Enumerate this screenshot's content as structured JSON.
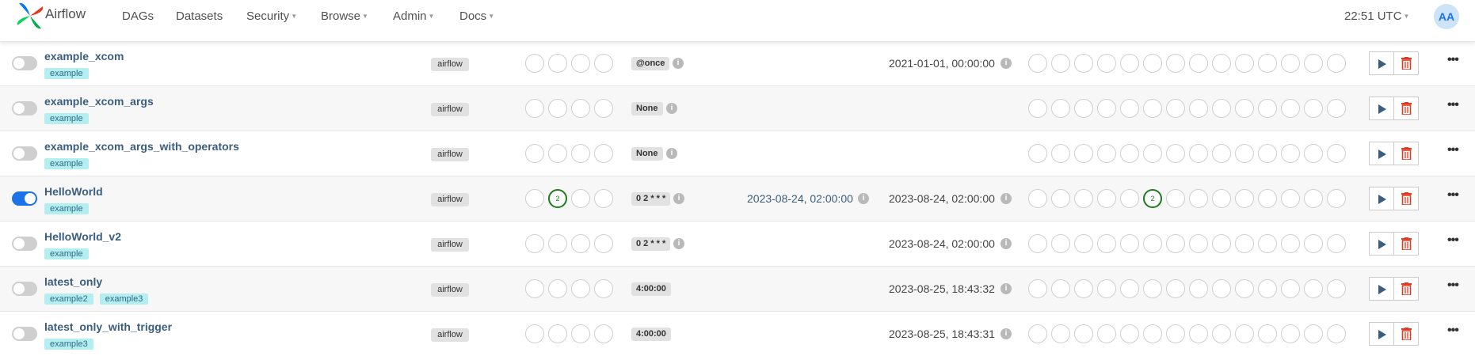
{
  "nav": {
    "brand": "Airflow",
    "items": [
      "DAGs",
      "Datasets",
      "Security",
      "Browse",
      "Admin",
      "Docs"
    ],
    "clock": "22:51 UTC",
    "avatar": "AA"
  },
  "rows": [
    {
      "name": "example_xcom",
      "tags": [
        "example"
      ],
      "owner": "airflow",
      "schedule": "@once",
      "next_run": "",
      "last_run": "2021-01-01, 00:00:00",
      "paused": true,
      "recent_success_slot": -1,
      "recent_success_count": "",
      "run_success_slot": -1,
      "run_success_count": ""
    },
    {
      "name": "example_xcom_args",
      "tags": [
        "example"
      ],
      "owner": "airflow",
      "schedule": "None",
      "next_run": "",
      "last_run": "",
      "paused": true,
      "recent_success_slot": -1,
      "recent_success_count": "",
      "run_success_slot": -1,
      "run_success_count": ""
    },
    {
      "name": "example_xcom_args_with_operators",
      "tags": [
        "example"
      ],
      "owner": "airflow",
      "schedule": "None",
      "next_run": "",
      "last_run": "",
      "paused": true,
      "recent_success_slot": -1,
      "recent_success_count": "",
      "run_success_slot": -1,
      "run_success_count": ""
    },
    {
      "name": "HelloWorld",
      "tags": [
        "example"
      ],
      "owner": "airflow",
      "schedule": "0 2 * * *",
      "next_run": "2023-08-24, 02:00:00",
      "last_run": "2023-08-24, 02:00:00",
      "paused": false,
      "recent_success_slot": 1,
      "recent_success_count": "2",
      "run_success_slot": 5,
      "run_success_count": "2"
    },
    {
      "name": "HelloWorld_v2",
      "tags": [
        "example"
      ],
      "owner": "airflow",
      "schedule": "0 2 * * *",
      "next_run": "",
      "last_run": "2023-08-24, 02:00:00",
      "paused": true,
      "recent_success_slot": -1,
      "recent_success_count": "",
      "run_success_slot": -1,
      "run_success_count": ""
    },
    {
      "name": "latest_only",
      "tags": [
        "example2",
        "example3"
      ],
      "owner": "airflow",
      "schedule": "4:00:00",
      "next_run": "",
      "last_run": "2023-08-25, 18:43:32",
      "paused": true,
      "recent_success_slot": -1,
      "recent_success_count": "",
      "run_success_slot": -1,
      "run_success_count": ""
    },
    {
      "name": "latest_only_with_trigger",
      "tags": [
        "example3"
      ],
      "owner": "airflow",
      "schedule": "4:00:00",
      "next_run": "",
      "last_run": "2023-08-25, 18:43:31",
      "paused": true,
      "recent_success_slot": -1,
      "recent_success_count": "",
      "run_success_slot": -1,
      "run_success_count": ""
    }
  ],
  "icons": {
    "logo": "airflow-pinwheel-logo",
    "info": "info-icon",
    "trigger": "play-icon",
    "delete": "trash-icon",
    "more": "ellipsis-icon"
  },
  "colors": {
    "accent": "#1c72e8",
    "success": "#1f7a1f",
    "tag_bg": "#b5eef0",
    "delete": "#e43921"
  }
}
